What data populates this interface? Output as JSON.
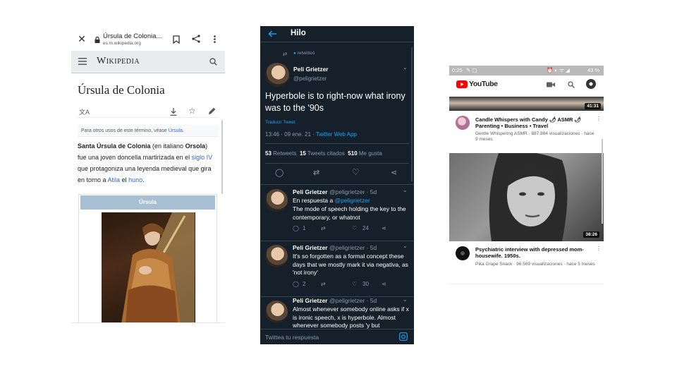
{
  "wikipedia": {
    "page_title_short": "Úrsula de Colonia...",
    "domain": "es.m.wikipedia.org",
    "logo": "Wikipedia",
    "article_title": "Úrsula de Colonia",
    "hatnote_prefix": "Para otros usos de este término, véase ",
    "hatnote_link": "Úrsula",
    "hatnote_suffix": ".",
    "intro": {
      "b1": "Santa Úrsula de Colonia",
      "t1": " (en italiano ",
      "b2": "Orsola",
      "t2": ") fue una joven doncella martirizada en el ",
      "l1": "siglo IV",
      "t3": " que protagoniza una leyenda medieval que gira en torno a ",
      "l2": "Atila",
      "t4": " el ",
      "l3": "huno",
      "t5": "."
    },
    "infobox_caption": "Úrsula",
    "icons": [
      "close-icon",
      "lock-icon",
      "bookmark-icon",
      "share-icon",
      "more-vert-icon",
      "menu-icon",
      "search-icon",
      "translate-icon",
      "download-icon",
      "star-icon",
      "edit-icon"
    ]
  },
  "twitter": {
    "header_title": "Hilo",
    "retweeted_label": "retwitteó",
    "main": {
      "name": "Peli Grietzer",
      "handle": "@peligrietzer",
      "text": "Hyperbole is to right-now what irony was to the '90s",
      "translate": "Traducir Tweet",
      "time": "13:46 · 09 ene. 21 · ",
      "client": "Twitter Web App",
      "retweets_count": "53",
      "retweets_label": " Retweets",
      "quotes_count": "15",
      "quotes_label": " Tweets citados",
      "likes_count": "510",
      "likes_label": " Me gusta"
    },
    "replies": [
      {
        "name": "Peli Grietzer",
        "handle_time": "@peligrietzer · 5d",
        "reply_prefix": "En respuesta a ",
        "reply_to": "@peligrietzer",
        "text": "The mode of speech holding the key to the contemporary, or whatnot",
        "replies": "1",
        "retweets": "",
        "likes": "24"
      },
      {
        "name": "Peli Grietzer",
        "handle_time": "@peligrietzer · 5d",
        "text": "It's so forgotten as a formal concept these days that we mostly mark it via negativa, as 'not irony'",
        "replies": "2",
        "retweets": "",
        "likes": "30"
      },
      {
        "name": "Peli Grietzer",
        "handle_time": "@peligrietzer · 5d",
        "text": "Almost whenever somebody online asks if x is ironic speech, x is hyperbole. Almost whenever somebody posts 'y but"
      }
    ],
    "compose_placeholder": "Twittea tu respuesta",
    "colors": {
      "bg": "#15202b",
      "accent": "#1da1f2"
    }
  },
  "youtube": {
    "status_time": "0:25",
    "status_battery": "43 %",
    "brand": "YouTube",
    "top_duration": "41:31",
    "video1": {
      "title": "Candle Whispers with Candy 🌶 ASMR 🌶 Parenting • Business • Travel",
      "meta": "Gentle Whispering ASMR · 887.884 visualizaciones · hace 9 meses"
    },
    "video2": {
      "duration": "38:26",
      "title": "Psychiatric interview with depressed mom-housewife. 1950s.",
      "meta": "Pika Grape Snack · 96.569 visualizaciones · hace 5 meses"
    },
    "colors": {
      "brand_red": "#ff0000"
    }
  }
}
